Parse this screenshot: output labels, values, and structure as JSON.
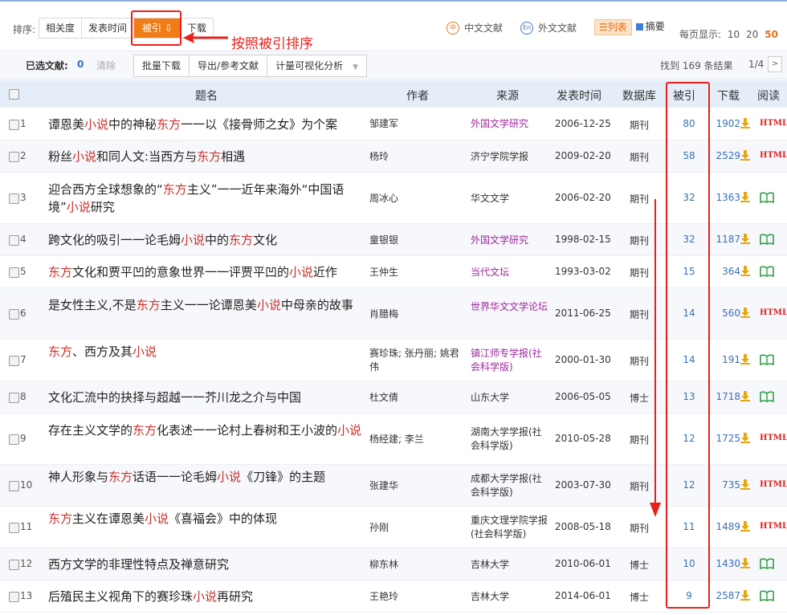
{
  "sort": {
    "label": "排序:",
    "buttons": [
      "相关度",
      "发表时间",
      "被引",
      "下载"
    ],
    "active_index": 2,
    "active_arrow": "down-arrow-icon"
  },
  "annotation": {
    "text": "按照被引排序"
  },
  "categories": [
    {
      "icon": "中",
      "label": "中文文献"
    },
    {
      "icon": "En",
      "label": "外文文献"
    }
  ],
  "view": {
    "list": "列表",
    "summary": "摘要"
  },
  "perpage": {
    "label": "每页显示:",
    "options": [
      "10",
      "20",
      "50"
    ],
    "selected": "50"
  },
  "toolbar": {
    "selected_label": "已选文献:",
    "selected_count": "0",
    "clear": "清除",
    "buttons": [
      "批量下载",
      "导出/参考文献",
      "计量可视化分析"
    ],
    "found": "找到 169 条结果",
    "page": "1/4",
    "next": ">"
  },
  "headers": {
    "title": "题名",
    "author": "作者",
    "source": "来源",
    "date": "发表时间",
    "db": "数据库",
    "cited": "被引",
    "download": "下载",
    "read": "阅读"
  },
  "colors": {
    "accent": "#f07c18",
    "highlight": "#c9302c",
    "source_purple": "#a0289e",
    "annotation": "#e8201c"
  },
  "rows": [
    {
      "n": "1",
      "title": [
        [
          "谭恩美",
          0
        ],
        [
          "小说",
          1
        ],
        [
          "中的神秘",
          0
        ],
        [
          "东方",
          1
        ],
        [
          "一一以《接骨师之女》为个案",
          0
        ]
      ],
      "author": "邹建军",
      "source": "外国文学研究",
      "source_purple": true,
      "date": "2006-12-25",
      "db": "期刊",
      "cited": "80",
      "dl": "1902",
      "read": "html"
    },
    {
      "n": "2",
      "title": [
        [
          "粉丝",
          0
        ],
        [
          "小说",
          1
        ],
        [
          "和同人文:当西方与",
          0
        ],
        [
          "东方",
          1
        ],
        [
          "相遇",
          0
        ]
      ],
      "author": "杨玲",
      "source": "济宁学院学报",
      "source_purple": false,
      "date": "2009-02-20",
      "db": "期刊",
      "cited": "58",
      "dl": "2529",
      "read": "html"
    },
    {
      "n": "3",
      "title": [
        [
          "迎合西方全球想象的“",
          0
        ],
        [
          "东方",
          1
        ],
        [
          "主义”一一近年来海外“中国语境”",
          0
        ],
        [
          "小说",
          1
        ],
        [
          "研究",
          0
        ]
      ],
      "author": "周冰心",
      "source": "华文文学",
      "source_purple": false,
      "date": "2006-02-20",
      "db": "期刊",
      "cited": "32",
      "dl": "1363",
      "read": "book"
    },
    {
      "n": "4",
      "title": [
        [
          "跨文化的吸引一一论毛姆",
          0
        ],
        [
          "小说",
          1
        ],
        [
          "中的",
          0
        ],
        [
          "东方",
          1
        ],
        [
          "文化",
          0
        ]
      ],
      "author": "童银银",
      "source": "外国文学研究",
      "source_purple": true,
      "date": "1998-02-15",
      "db": "期刊",
      "cited": "32",
      "dl": "1187",
      "read": "book"
    },
    {
      "n": "5",
      "title": [
        [
          "东方",
          1
        ],
        [
          "文化和贾平凹的意象世界一一评贾平凹的",
          0
        ],
        [
          "小说",
          1
        ],
        [
          "近作",
          0
        ]
      ],
      "author": "王仲生",
      "source": "当代文坛",
      "source_purple": true,
      "date": "1993-03-02",
      "db": "期刊",
      "cited": "15",
      "dl": "364",
      "read": "book"
    },
    {
      "n": "6",
      "title": [
        [
          "是女性主义,不是",
          0
        ],
        [
          "东方",
          1
        ],
        [
          "主义一一论谭恩美",
          0
        ],
        [
          "小说",
          1
        ],
        [
          "中母亲的故事",
          0
        ]
      ],
      "author": "肖腊梅",
      "source": "世界华文文学论坛",
      "source_purple": true,
      "date": "2011-06-25",
      "db": "期刊",
      "cited": "14",
      "dl": "560",
      "read": "html"
    },
    {
      "n": "7",
      "title": [
        [
          "东方",
          1
        ],
        [
          "、西方及其",
          0
        ],
        [
          "小说",
          1
        ]
      ],
      "author": "赛珍珠; 张丹丽; 姚君伟",
      "source": "镇江师专学报(社会科学版)",
      "source_purple": true,
      "date": "2000-01-30",
      "db": "期刊",
      "cited": "14",
      "dl": "191",
      "read": "book"
    },
    {
      "n": "8",
      "title": [
        [
          "文化汇流中的抉择与超越一一芥川龙之介与中国",
          0
        ]
      ],
      "author": "杜文倩",
      "source": "山东大学",
      "source_purple": false,
      "date": "2006-05-05",
      "db": "博士",
      "cited": "13",
      "dl": "1718",
      "read": "book"
    },
    {
      "n": "9",
      "title": [
        [
          "存在主义文学的",
          0
        ],
        [
          "东方",
          1
        ],
        [
          "化表述一一论村上春树和王小波的",
          0
        ],
        [
          "小说",
          1
        ]
      ],
      "author": "杨经建; 李兰",
      "source": "湖南大学学报(社会科学版)",
      "source_purple": false,
      "date": "2010-05-28",
      "db": "期刊",
      "cited": "12",
      "dl": "1725",
      "read": "html"
    },
    {
      "n": "10",
      "title": [
        [
          "神人形象与",
          0
        ],
        [
          "东方",
          1
        ],
        [
          "话语一一论毛姆",
          0
        ],
        [
          "小说",
          1
        ],
        [
          "《刀锋》的主题",
          0
        ]
      ],
      "author": "张建华",
      "source": "成都大学学报(社会科学版)",
      "source_purple": false,
      "date": "2003-07-30",
      "db": "期刊",
      "cited": "12",
      "dl": "735",
      "read": "html"
    },
    {
      "n": "11",
      "title": [
        [
          "东方",
          1
        ],
        [
          "主义在谭恩美",
          0
        ],
        [
          "小说",
          1
        ],
        [
          "《喜福会》中的体现",
          0
        ]
      ],
      "author": "孙刚",
      "source": "重庆文理学院学报(社会科学版)",
      "source_purple": false,
      "date": "2008-05-18",
      "db": "期刊",
      "cited": "11",
      "dl": "1489",
      "read": "html"
    },
    {
      "n": "12",
      "title": [
        [
          "西方文学的非理性特点及禅意研究",
          0
        ]
      ],
      "author": "柳东林",
      "source": "吉林大学",
      "source_purple": false,
      "date": "2010-06-01",
      "db": "博士",
      "cited": "10",
      "dl": "1430",
      "read": "book"
    },
    {
      "n": "13",
      "title": [
        [
          "后殖民主义视角下的赛珍珠",
          0
        ],
        [
          "小说",
          1
        ],
        [
          "再研究",
          0
        ]
      ],
      "author": "王艳玲",
      "source": "吉林大学",
      "source_purple": false,
      "date": "2014-06-01",
      "db": "博士",
      "cited": "9",
      "dl": "2587",
      "read": "book"
    }
  ]
}
